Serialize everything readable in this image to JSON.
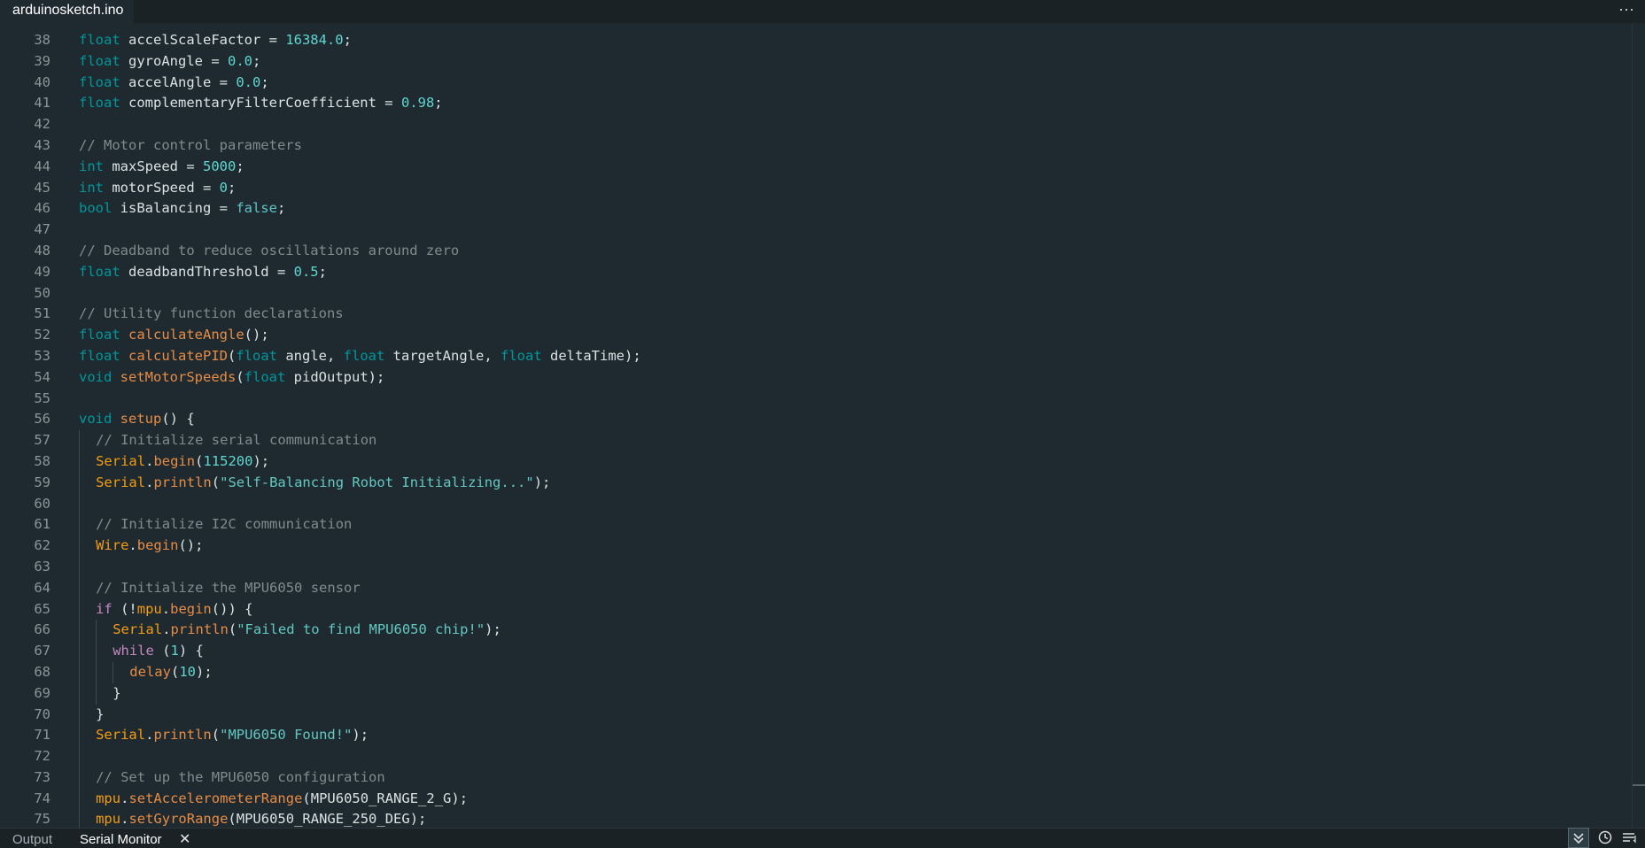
{
  "tab": {
    "filename": "arduinosketch.ino"
  },
  "toolbar": {
    "more_label": "···"
  },
  "bottom_panel": {
    "tabs": [
      {
        "label": "Output"
      },
      {
        "label": "Serial Monitor"
      }
    ],
    "close_label": "✕",
    "icons": [
      "autoscroll-icon",
      "timestamp-icon",
      "line-ending-icon"
    ]
  },
  "colors": {
    "background": "#1f2a30",
    "type_keyword": "#00979c",
    "control_keyword": "#c586c0",
    "number": "#5fd6d0",
    "string": "#63c7c2",
    "comment": "#7f8c8d",
    "function": "#e78c45",
    "object": "#f39c12"
  },
  "code": {
    "lines": [
      {
        "n": "38",
        "indent": 0,
        "tokens": [
          [
            "t",
            "float"
          ],
          [
            "p",
            " accelScaleFactor = "
          ],
          [
            "n",
            "16384.0"
          ],
          [
            "p",
            ";"
          ]
        ]
      },
      {
        "n": "39",
        "indent": 0,
        "tokens": [
          [
            "t",
            "float"
          ],
          [
            "p",
            " gyroAngle = "
          ],
          [
            "n",
            "0.0"
          ],
          [
            "p",
            ";"
          ]
        ]
      },
      {
        "n": "40",
        "indent": 0,
        "tokens": [
          [
            "t",
            "float"
          ],
          [
            "p",
            " accelAngle = "
          ],
          [
            "n",
            "0.0"
          ],
          [
            "p",
            ";"
          ]
        ]
      },
      {
        "n": "41",
        "indent": 0,
        "tokens": [
          [
            "t",
            "float"
          ],
          [
            "p",
            " complementaryFilterCoefficient = "
          ],
          [
            "n",
            "0.98"
          ],
          [
            "p",
            ";"
          ]
        ]
      },
      {
        "n": "42",
        "indent": 0,
        "tokens": []
      },
      {
        "n": "43",
        "indent": 0,
        "tokens": [
          [
            "c",
            "// Motor control parameters"
          ]
        ]
      },
      {
        "n": "44",
        "indent": 0,
        "tokens": [
          [
            "t",
            "int"
          ],
          [
            "p",
            " maxSpeed = "
          ],
          [
            "n",
            "5000"
          ],
          [
            "p",
            ";"
          ]
        ]
      },
      {
        "n": "45",
        "indent": 0,
        "tokens": [
          [
            "t",
            "int"
          ],
          [
            "p",
            " motorSpeed = "
          ],
          [
            "n",
            "0"
          ],
          [
            "p",
            ";"
          ]
        ]
      },
      {
        "n": "46",
        "indent": 0,
        "tokens": [
          [
            "t",
            "bool"
          ],
          [
            "p",
            " isBalancing = "
          ],
          [
            "l",
            "false"
          ],
          [
            "p",
            ";"
          ]
        ]
      },
      {
        "n": "47",
        "indent": 0,
        "tokens": []
      },
      {
        "n": "48",
        "indent": 0,
        "tokens": [
          [
            "c",
            "// Deadband to reduce oscillations around zero"
          ]
        ]
      },
      {
        "n": "49",
        "indent": 0,
        "tokens": [
          [
            "t",
            "float"
          ],
          [
            "p",
            " deadbandThreshold = "
          ],
          [
            "n",
            "0.5"
          ],
          [
            "p",
            ";"
          ]
        ]
      },
      {
        "n": "50",
        "indent": 0,
        "tokens": []
      },
      {
        "n": "51",
        "indent": 0,
        "tokens": [
          [
            "c",
            "// Utility function declarations"
          ]
        ]
      },
      {
        "n": "52",
        "indent": 0,
        "tokens": [
          [
            "t",
            "float"
          ],
          [
            "p",
            " "
          ],
          [
            "f",
            "calculateAngle"
          ],
          [
            "p",
            "();"
          ]
        ]
      },
      {
        "n": "53",
        "indent": 0,
        "tokens": [
          [
            "t",
            "float"
          ],
          [
            "p",
            " "
          ],
          [
            "f",
            "calculatePID"
          ],
          [
            "p",
            "("
          ],
          [
            "t",
            "float"
          ],
          [
            "p",
            " angle, "
          ],
          [
            "t",
            "float"
          ],
          [
            "p",
            " targetAngle, "
          ],
          [
            "t",
            "float"
          ],
          [
            "p",
            " deltaTime);"
          ]
        ]
      },
      {
        "n": "54",
        "indent": 0,
        "tokens": [
          [
            "t",
            "void"
          ],
          [
            "p",
            " "
          ],
          [
            "f",
            "setMotorSpeeds"
          ],
          [
            "p",
            "("
          ],
          [
            "t",
            "float"
          ],
          [
            "p",
            " pidOutput);"
          ]
        ]
      },
      {
        "n": "55",
        "indent": 0,
        "tokens": []
      },
      {
        "n": "56",
        "indent": 0,
        "tokens": [
          [
            "t",
            "void"
          ],
          [
            "p",
            " "
          ],
          [
            "f",
            "setup"
          ],
          [
            "p",
            "() {"
          ]
        ]
      },
      {
        "n": "57",
        "indent": 1,
        "tokens": [
          [
            "c",
            "// Initialize serial communication"
          ]
        ]
      },
      {
        "n": "58",
        "indent": 1,
        "tokens": [
          [
            "o",
            "Serial"
          ],
          [
            "p",
            "."
          ],
          [
            "f",
            "begin"
          ],
          [
            "p",
            "("
          ],
          [
            "n",
            "115200"
          ],
          [
            "p",
            ");"
          ]
        ]
      },
      {
        "n": "59",
        "indent": 1,
        "tokens": [
          [
            "o",
            "Serial"
          ],
          [
            "p",
            "."
          ],
          [
            "f",
            "println"
          ],
          [
            "p",
            "("
          ],
          [
            "s",
            "\"Self-Balancing Robot Initializing...\""
          ],
          [
            "p",
            ");"
          ]
        ]
      },
      {
        "n": "60",
        "indent": 1,
        "tokens": []
      },
      {
        "n": "61",
        "indent": 1,
        "tokens": [
          [
            "c",
            "// Initialize I2C communication"
          ]
        ]
      },
      {
        "n": "62",
        "indent": 1,
        "tokens": [
          [
            "o",
            "Wire"
          ],
          [
            "p",
            "."
          ],
          [
            "f",
            "begin"
          ],
          [
            "p",
            "();"
          ]
        ]
      },
      {
        "n": "63",
        "indent": 1,
        "tokens": []
      },
      {
        "n": "64",
        "indent": 1,
        "tokens": [
          [
            "c",
            "// Initialize the MPU6050 sensor"
          ]
        ]
      },
      {
        "n": "65",
        "indent": 1,
        "tokens": [
          [
            "k",
            "if"
          ],
          [
            "p",
            " (!"
          ],
          [
            "o",
            "mpu"
          ],
          [
            "p",
            "."
          ],
          [
            "f",
            "begin"
          ],
          [
            "p",
            "()) {"
          ]
        ]
      },
      {
        "n": "66",
        "indent": 2,
        "tokens": [
          [
            "o",
            "Serial"
          ],
          [
            "p",
            "."
          ],
          [
            "f",
            "println"
          ],
          [
            "p",
            "("
          ],
          [
            "s",
            "\"Failed to find MPU6050 chip!\""
          ],
          [
            "p",
            ");"
          ]
        ]
      },
      {
        "n": "67",
        "indent": 2,
        "tokens": [
          [
            "k",
            "while"
          ],
          [
            "p",
            " ("
          ],
          [
            "n",
            "1"
          ],
          [
            "p",
            ") {"
          ]
        ]
      },
      {
        "n": "68",
        "indent": 3,
        "tokens": [
          [
            "f",
            "delay"
          ],
          [
            "p",
            "("
          ],
          [
            "n",
            "10"
          ],
          [
            "p",
            ");"
          ]
        ]
      },
      {
        "n": "69",
        "indent": 2,
        "tokens": [
          [
            "p",
            "}"
          ]
        ]
      },
      {
        "n": "70",
        "indent": 1,
        "tokens": [
          [
            "p",
            "}"
          ]
        ]
      },
      {
        "n": "71",
        "indent": 1,
        "tokens": [
          [
            "o",
            "Serial"
          ],
          [
            "p",
            "."
          ],
          [
            "f",
            "println"
          ],
          [
            "p",
            "("
          ],
          [
            "s",
            "\"MPU6050 Found!\""
          ],
          [
            "p",
            ");"
          ]
        ]
      },
      {
        "n": "72",
        "indent": 1,
        "tokens": []
      },
      {
        "n": "73",
        "indent": 1,
        "tokens": [
          [
            "c",
            "// Set up the MPU6050 configuration"
          ]
        ]
      },
      {
        "n": "74",
        "indent": 1,
        "tokens": [
          [
            "o",
            "mpu"
          ],
          [
            "p",
            "."
          ],
          [
            "f",
            "setAccelerometerRange"
          ],
          [
            "p",
            "(MPU6050_RANGE_2_G);"
          ]
        ]
      },
      {
        "n": "75",
        "indent": 1,
        "tokens": [
          [
            "o",
            "mpu"
          ],
          [
            "p",
            "."
          ],
          [
            "f",
            "setGyroRange"
          ],
          [
            "p",
            "(MPU6050_RANGE_250_DEG);"
          ]
        ]
      }
    ]
  }
}
